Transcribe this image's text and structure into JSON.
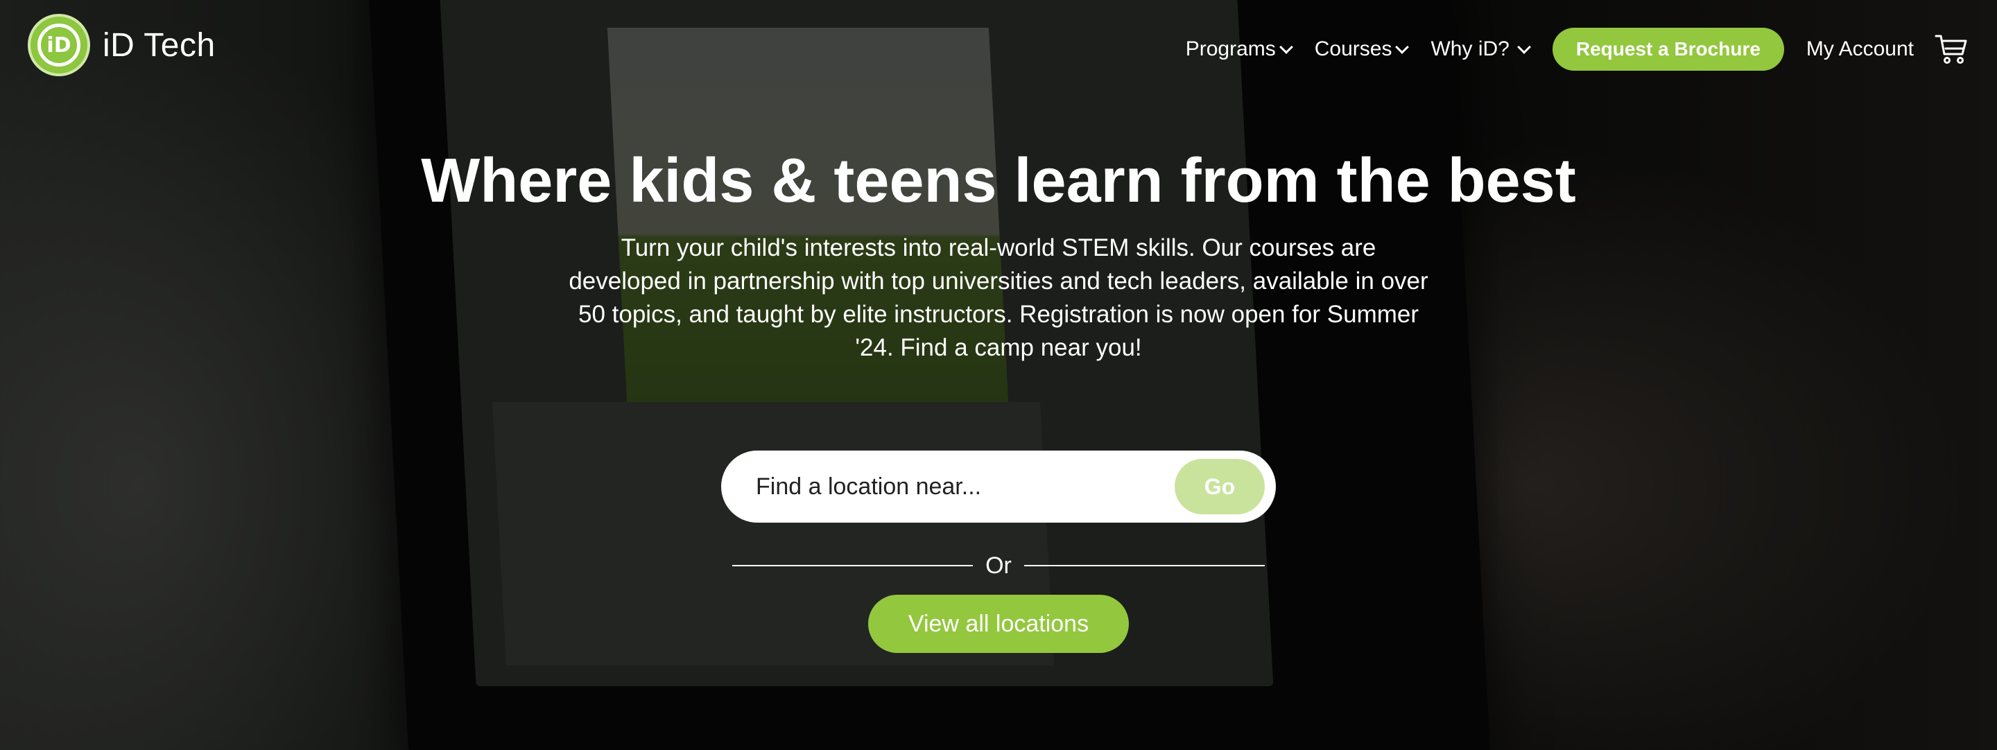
{
  "header": {
    "logo_text": "iD Tech",
    "logo_mark": "iD",
    "nav": [
      {
        "label": "Programs"
      },
      {
        "label": "Courses"
      },
      {
        "label": "Why iD?"
      }
    ],
    "brochure_label": "Request a Brochure",
    "account_label": "My Account",
    "cart_icon": "cart-icon"
  },
  "hero": {
    "title": "Where kids & teens learn from the best",
    "description": "Turn your child's interests into real-world STEM skills. Our courses are developed in partnership with top universities and tech leaders, available in over 50 topics, and taught by elite instructors. Registration is now open for Summer '24. Find a camp near you!",
    "search_placeholder": "Find a location near...",
    "go_label": "Go",
    "or_label": "Or",
    "view_all_label": "View all locations"
  },
  "colors": {
    "accent": "#93c73e",
    "go_button": "#c9e39c"
  }
}
